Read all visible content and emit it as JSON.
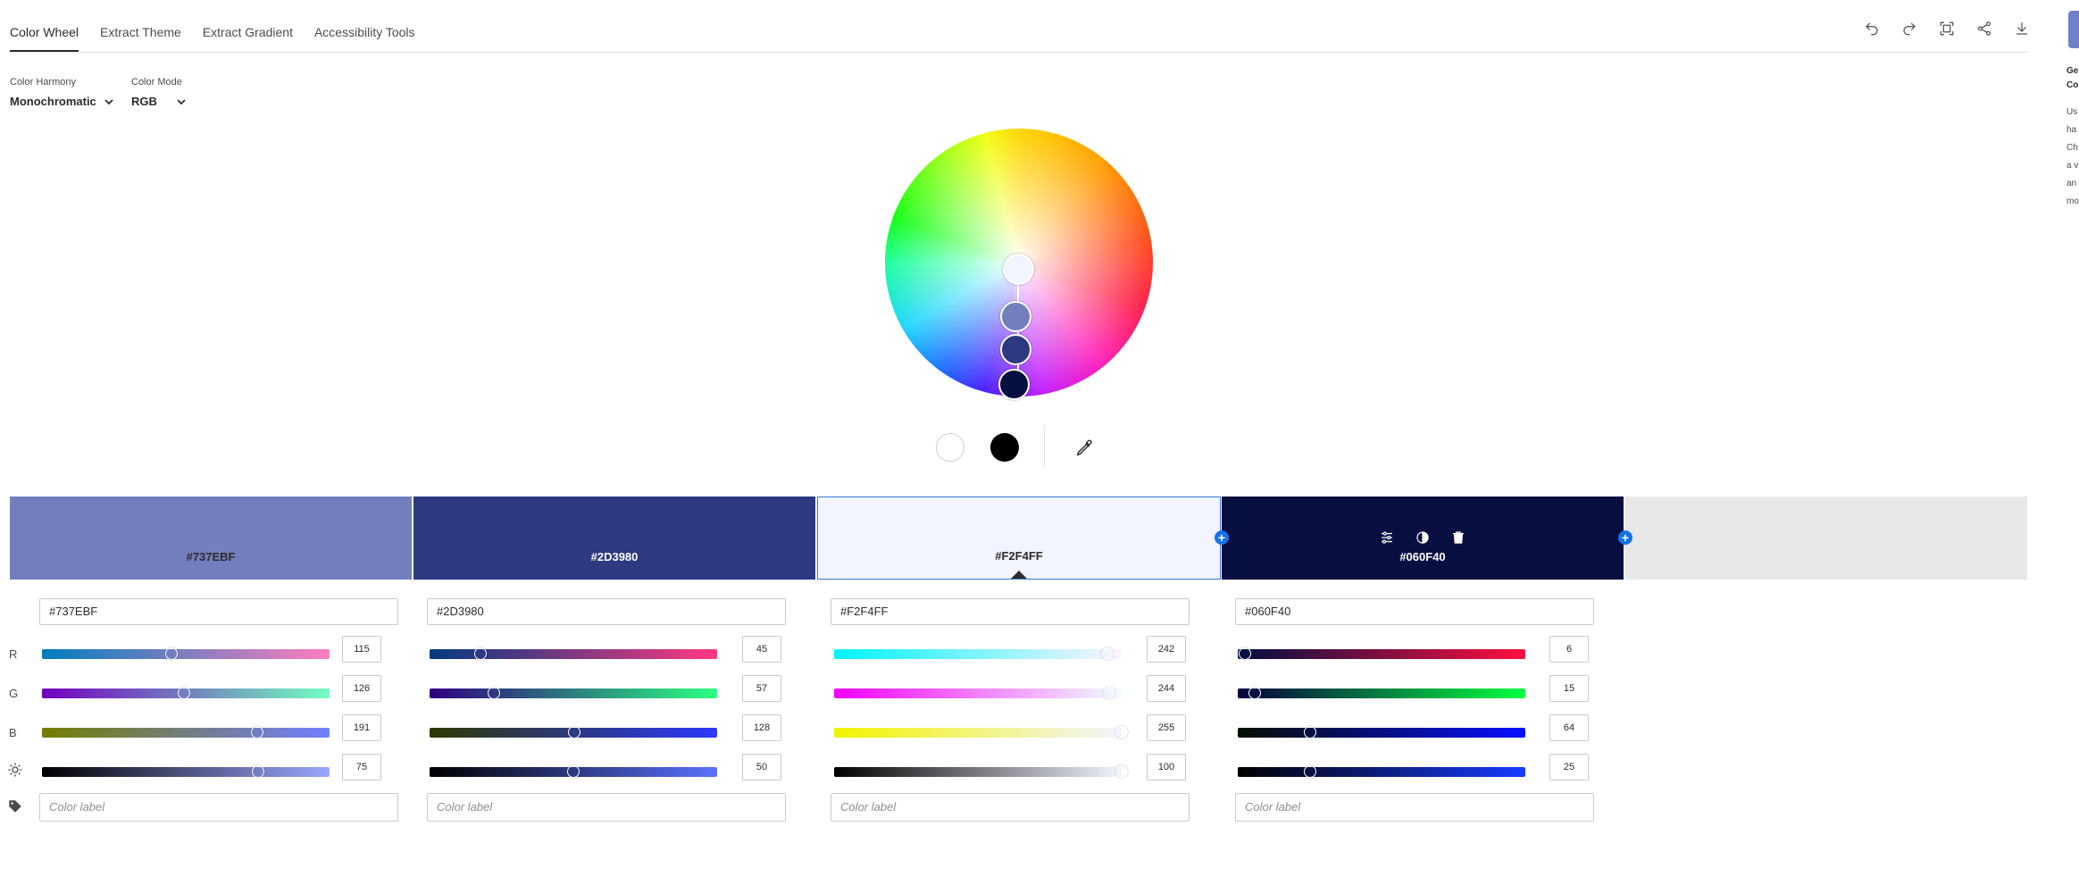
{
  "tabs": [
    "Color Wheel",
    "Extract Theme",
    "Extract Gradient",
    "Accessibility Tools"
  ],
  "toolbar": [
    "undo-icon",
    "redo-icon",
    "fit-screen-icon",
    "share-icon",
    "download-icon"
  ],
  "pickers": {
    "harmony": {
      "label": "Color Harmony",
      "value": "Monochromatic"
    },
    "mode": {
      "label": "Color Mode",
      "value": "RGB"
    }
  },
  "side_panel": {
    "title_fragment": "Ge",
    "title_fragment2": "Co",
    "body_lines": [
      "Us",
      "ha",
      "Ch",
      "a v",
      "an",
      "mo"
    ]
  },
  "base_colors": {
    "white": "#ffffff",
    "black": "#000000"
  },
  "swatches": [
    {
      "hex": "#737EBF",
      "color": "#737EBF",
      "text_color": "#2c2c2c",
      "r": 115,
      "g": 126,
      "b": 191,
      "brightness": 75,
      "label_placeholder": "Color label"
    },
    {
      "hex": "#2D3980",
      "color": "#2D3980",
      "text_color": "#ffffff",
      "r": 45,
      "g": 57,
      "b": 128,
      "brightness": 50,
      "label_placeholder": "Color label"
    },
    {
      "hex": "#F2F4FF",
      "color": "#F2F4FF",
      "text_color": "#2c2c2c",
      "r": 242,
      "g": 244,
      "b": 255,
      "brightness": 100,
      "label_placeholder": "Color label",
      "selected": true
    },
    {
      "hex": "#060F40",
      "color": "#060F40",
      "text_color": "#ffffff",
      "r": 6,
      "g": 15,
      "b": 64,
      "brightness": 25,
      "label_placeholder": "Color label"
    }
  ],
  "empty_slot_color": "#e8e8e8",
  "swatch_tools": [
    "adjust-icon",
    "contrast-icon",
    "trash-icon"
  ],
  "channels": [
    "R",
    "G",
    "B"
  ],
  "channel_icons": [
    "brightness-icon",
    "tag-icon"
  ]
}
